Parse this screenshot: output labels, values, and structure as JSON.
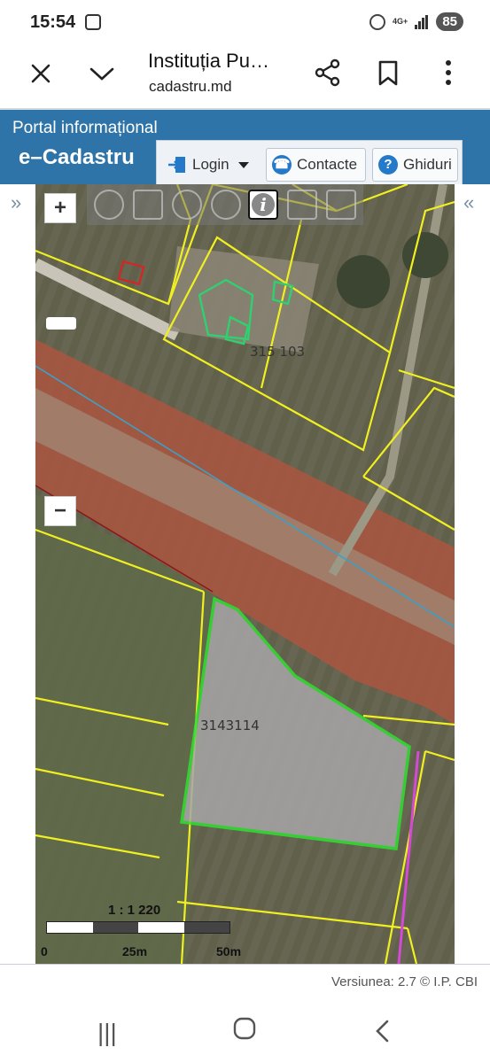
{
  "status": {
    "time": "15:54",
    "network": "4G+",
    "battery": "85"
  },
  "browser": {
    "title": "Instituția Pu…",
    "url": "cadastru.md"
  },
  "header": {
    "portal_label": "Portal informațional",
    "brand": "e–Cadastru"
  },
  "nav": {
    "login": "Login",
    "contacts": "Contacte",
    "guides": "Ghiduri"
  },
  "map": {
    "parcels": {
      "top": "315 103",
      "main": "3143114"
    },
    "scale_ratio": "1 : 1 220",
    "scale_ticks": [
      "0",
      "25m",
      "50m"
    ]
  },
  "footer": {
    "version": "Versiunea: 2.7 © I.P. CBI"
  }
}
